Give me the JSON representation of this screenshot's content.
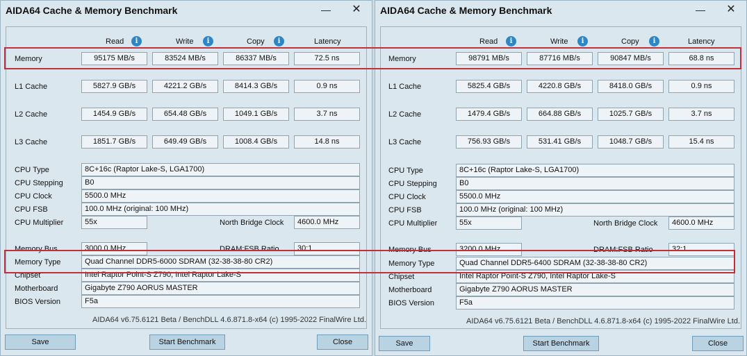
{
  "common": {
    "title": "AIDA64 Cache & Memory Benchmark",
    "minimize_glyph": "—",
    "close_glyph": "✕",
    "headers": {
      "read": "Read",
      "write": "Write",
      "copy": "Copy",
      "latency": "Latency"
    },
    "info_glyph": "i",
    "bench_labels": {
      "memory": "Memory",
      "l1": "L1 Cache",
      "l2": "L2 Cache",
      "l3": "L3 Cache"
    },
    "info_labels": {
      "cpu_type": "CPU Type",
      "cpu_stepping": "CPU Stepping",
      "cpu_clock": "CPU Clock",
      "cpu_fsb": "CPU FSB",
      "cpu_multiplier": "CPU Multiplier",
      "north_bridge_clock": "North Bridge Clock",
      "memory_bus": "Memory Bus",
      "dram_fsb_ratio": "DRAM:FSB Ratio",
      "memory_type": "Memory Type",
      "chipset": "Chipset",
      "motherboard": "Motherboard",
      "bios_version": "BIOS Version"
    },
    "footer": "AIDA64 v6.75.6121 Beta / BenchDLL 4.6.871.8-x64  (c) 1995-2022 FinalWire Ltd.",
    "buttons": {
      "save": "Save",
      "start": "Start Benchmark",
      "close": "Close"
    },
    "colors": {
      "highlight": "#c0303a",
      "button": "#b9d3e3",
      "info_icon": "#2f86c4"
    }
  },
  "left": {
    "memory": {
      "read": "95175 MB/s",
      "write": "83524 MB/s",
      "copy": "86337 MB/s",
      "latency": "72.5 ns"
    },
    "l1": {
      "read": "5827.9 GB/s",
      "write": "4221.2 GB/s",
      "copy": "8414.3 GB/s",
      "latency": "0.9 ns"
    },
    "l2": {
      "read": "1454.9 GB/s",
      "write": "654.48 GB/s",
      "copy": "1049.1 GB/s",
      "latency": "3.7 ns"
    },
    "l3": {
      "read": "1851.7 GB/s",
      "write": "649.49 GB/s",
      "copy": "1008.4 GB/s",
      "latency": "14.8 ns"
    },
    "cpu_type": "8C+16c   (Raptor Lake-S, LGA1700)",
    "cpu_stepping": "B0",
    "cpu_clock": "5500.0 MHz",
    "cpu_fsb": "100.0 MHz  (original: 100 MHz)",
    "cpu_multiplier": "55x",
    "north_bridge_clock": "4600.0 MHz",
    "memory_bus": "3000.0 MHz",
    "dram_fsb_ratio": "30:1",
    "memory_type": "Quad Channel DDR5-6000 SDRAM  (32-38-38-80 CR2)",
    "chipset": "Intel Raptor Point-S Z790, Intel Raptor Lake-S",
    "motherboard": "Gigabyte Z790 AORUS MASTER",
    "bios_version": "F5a"
  },
  "right": {
    "memory": {
      "read": "98791 MB/s",
      "write": "87716 MB/s",
      "copy": "90847 MB/s",
      "latency": "68.8 ns"
    },
    "l1": {
      "read": "5825.4 GB/s",
      "write": "4220.8 GB/s",
      "copy": "8418.0 GB/s",
      "latency": "0.9 ns"
    },
    "l2": {
      "read": "1479.4 GB/s",
      "write": "664.88 GB/s",
      "copy": "1025.7 GB/s",
      "latency": "3.7 ns"
    },
    "l3": {
      "read": "756.93 GB/s",
      "write": "531.41 GB/s",
      "copy": "1048.7 GB/s",
      "latency": "15.4 ns"
    },
    "cpu_type": "8C+16c   (Raptor Lake-S, LGA1700)",
    "cpu_stepping": "B0",
    "cpu_clock": "5500.0 MHz",
    "cpu_fsb": "100.0 MHz  (original: 100 MHz)",
    "cpu_multiplier": "55x",
    "north_bridge_clock": "4600.0 MHz",
    "memory_bus": "3200.0 MHz",
    "dram_fsb_ratio": "32:1",
    "memory_type": "Quad Channel DDR5-6400 SDRAM  (32-38-38-80 CR2)",
    "chipset": "Intel Raptor Point-S Z790, Intel Raptor Lake-S",
    "motherboard": "Gigabyte Z790 AORUS MASTER",
    "bios_version": "F5a"
  }
}
